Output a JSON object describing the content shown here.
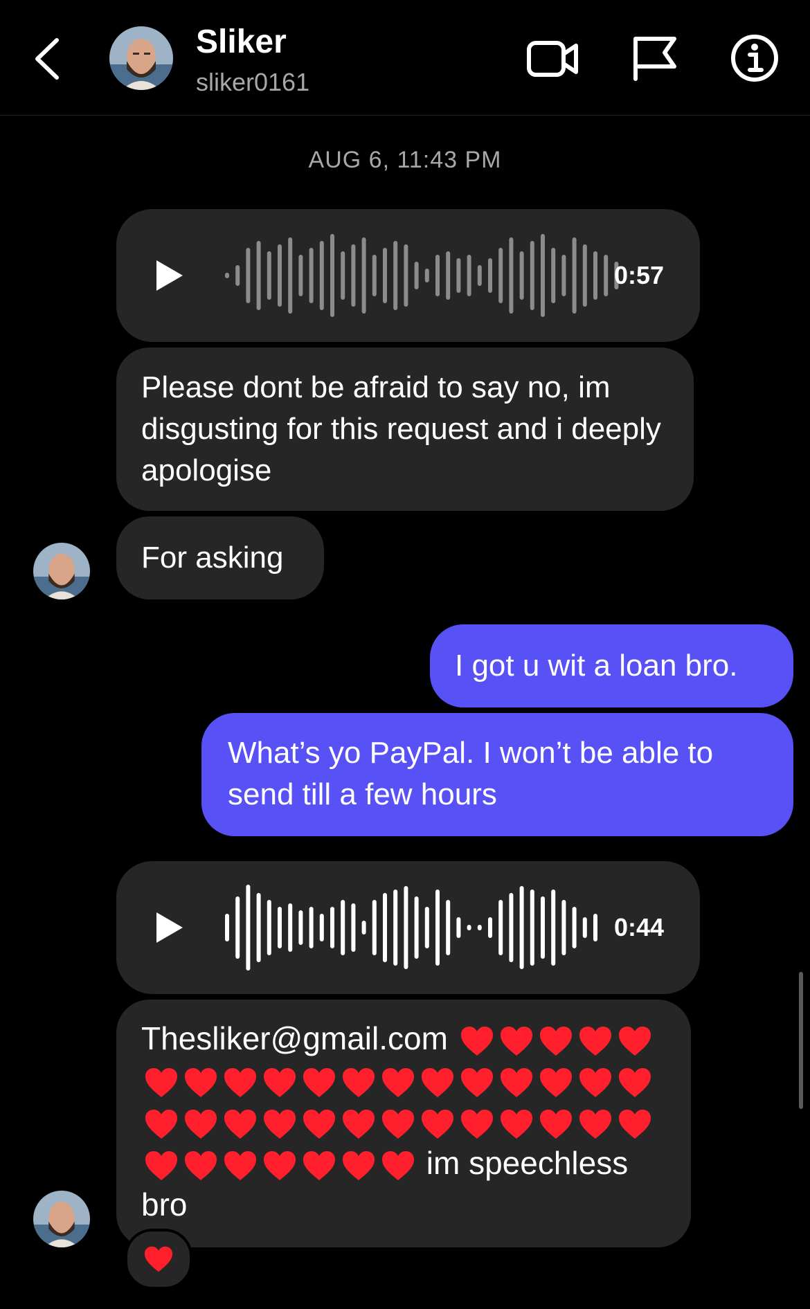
{
  "header": {
    "name": "Sliker",
    "username": "sliker0161"
  },
  "timestamp": "AUG 6, 11:43 PM",
  "messages": {
    "voice1_duration": "0:57",
    "text1": "Please dont be afraid to say no, im disgusting for this request and i deeply apologise",
    "text2": "For asking",
    "out1": "I got u wit a loan bro.",
    "out2": "What’s yo PayPal. I won’t be able to send till a few hours",
    "voice2_duration": "0:44",
    "email": "Thesliker@gmail.com",
    "closing": "im speechless bro",
    "heart_count": 38
  },
  "colors": {
    "outgoing_bubble": "#5851f6",
    "incoming_bubble": "#262626",
    "heart": "#ff1f2d"
  }
}
